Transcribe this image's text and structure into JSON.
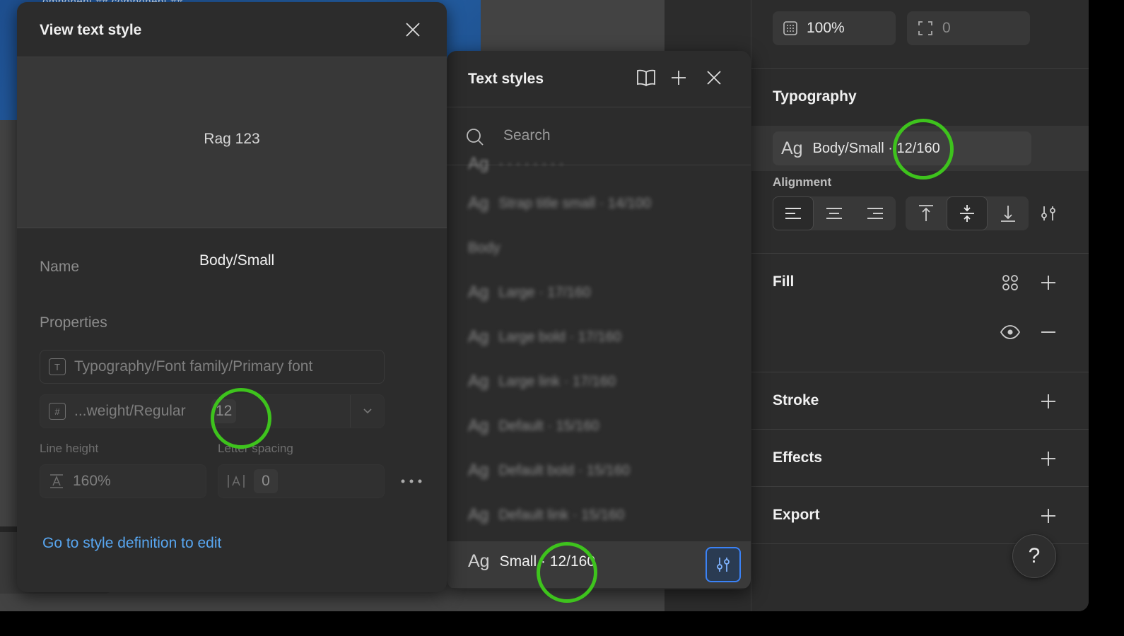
{
  "canvas": {
    "frame_label": "omponent     ##   component     ##"
  },
  "right_panel": {
    "opacity_value": "100%",
    "corner_value": "0",
    "typography": {
      "title": "Typography",
      "style_ag": "Ag",
      "style_label": "Body/Small · 12/160"
    },
    "alignment_label": "Alignment",
    "fill_title": "Fill",
    "stroke_title": "Stroke",
    "effects_title": "Effects",
    "export_title": "Export",
    "help_label": "?"
  },
  "text_styles_panel": {
    "title": "Text styles",
    "search_placeholder": "Search",
    "items": [
      {
        "ag": "Ag",
        "label": "Strap title small · 14/100"
      },
      {
        "ag": "",
        "label": "Body"
      },
      {
        "ag": "Ag",
        "label": "Large · 17/160"
      },
      {
        "ag": "Ag",
        "label": "Large bold · 17/160"
      },
      {
        "ag": "Ag",
        "label": "Large link · 17/160"
      },
      {
        "ag": "Ag",
        "label": "Default · 15/160"
      },
      {
        "ag": "Ag",
        "label": "Default bold · 15/160"
      },
      {
        "ag": "Ag",
        "label": "Default link · 15/160"
      }
    ],
    "selected": {
      "ag": "Ag",
      "label": "Small · 12/160"
    }
  },
  "view_text_style_panel": {
    "title": "View text style",
    "preview_text": "Rag 123",
    "name_label": "Name",
    "name_value": "Body/Small",
    "properties_label": "Properties",
    "font_family": "Typography/Font family/Primary font",
    "font_weight": "...weight/Regular",
    "font_size": "12",
    "line_height_label": "Line height",
    "line_height_value": "160%",
    "letter_spacing_label": "Letter spacing",
    "letter_spacing_value": "0",
    "edit_link": "Go to style definition to edit"
  },
  "colors": {
    "accent_blue": "#3b82f6",
    "link_blue": "#58a6f0",
    "highlight_green": "#3ec31d",
    "panel_bg": "#2c2c2c"
  }
}
